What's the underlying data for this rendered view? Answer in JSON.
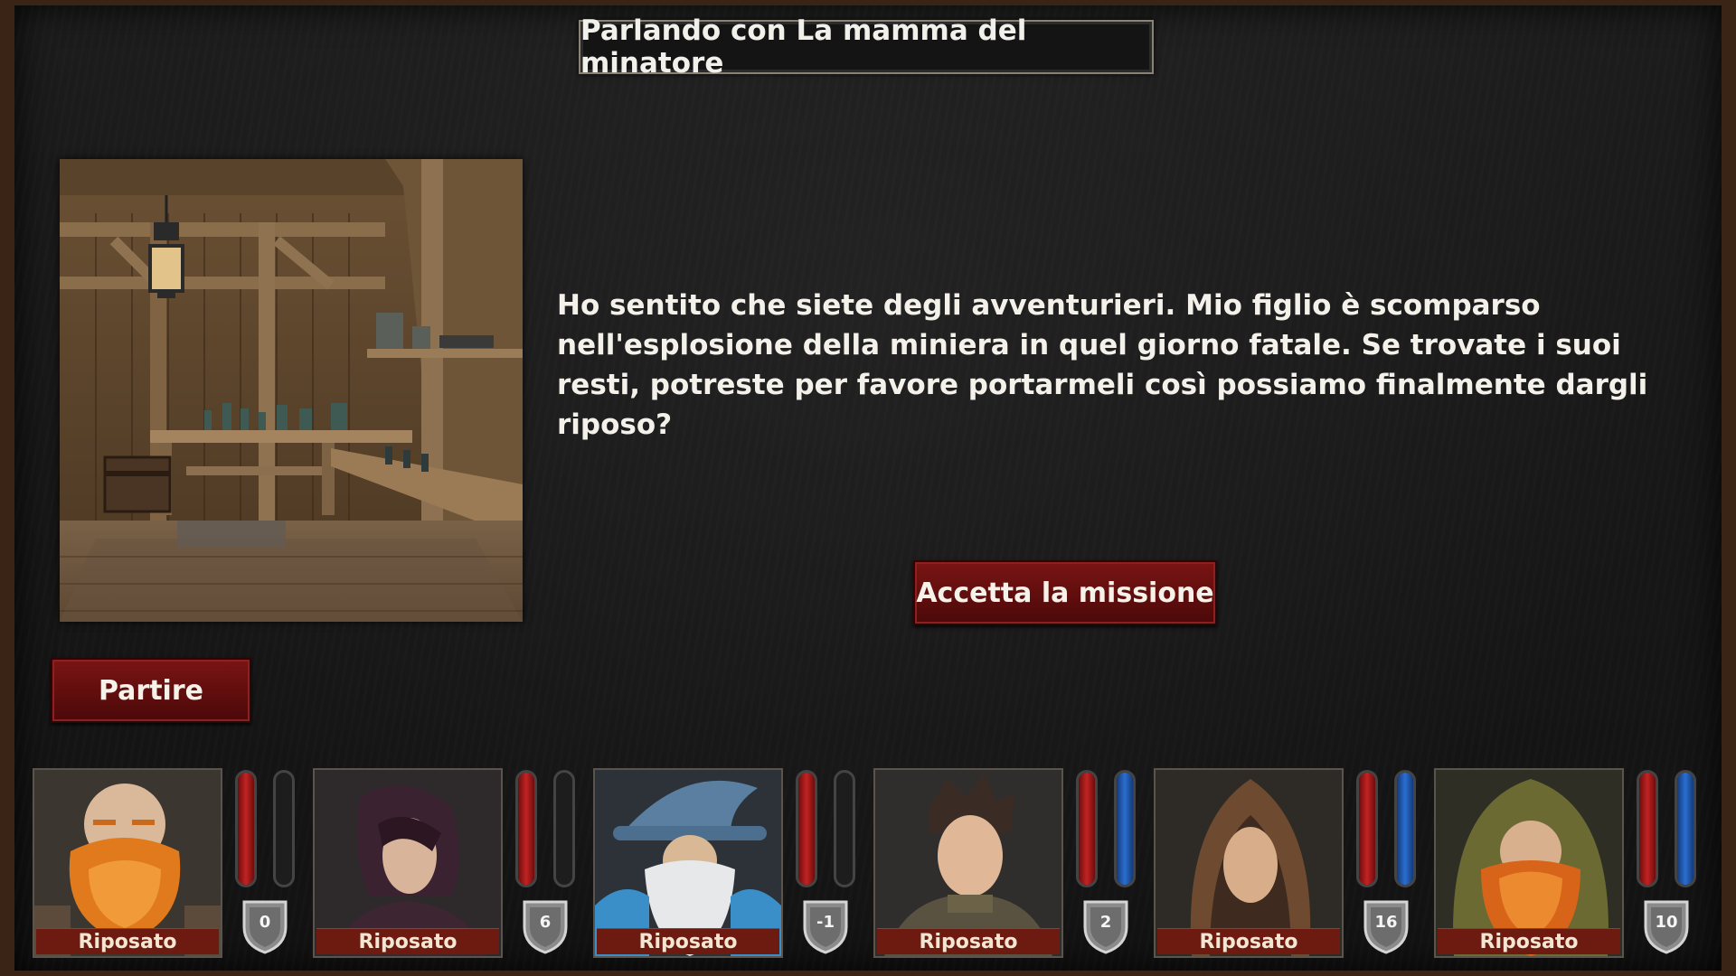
{
  "header": {
    "title": "Parlando con La mamma del minatore"
  },
  "dialogue": {
    "text": "Ho sentito che siete degli avventurieri. Mio figlio è scomparso nell'esplosione della miniera in quel giorno fatale. Se trovate i suoi resti, potreste per favore portarmeli così possiamo finalmente dargli riposo?"
  },
  "actions": {
    "accept_label": "Accetta la missione",
    "depart_label": "Partire"
  },
  "party": [
    {
      "status": "Riposato",
      "armor": "0",
      "hp_fraction": 1.0,
      "mp_fraction": 0.0,
      "portrait": "dwarf-bald"
    },
    {
      "status": "Riposato",
      "armor": "6",
      "hp_fraction": 1.0,
      "mp_fraction": 0.0,
      "portrait": "dark-haired-woman"
    },
    {
      "status": "Riposato",
      "armor": "-1",
      "hp_fraction": 1.0,
      "mp_fraction": 0.0,
      "portrait": "wizard"
    },
    {
      "status": "Riposato",
      "armor": "2",
      "hp_fraction": 1.0,
      "mp_fraction": 1.0,
      "portrait": "young-man"
    },
    {
      "status": "Riposato",
      "armor": "16",
      "hp_fraction": 1.0,
      "mp_fraction": 1.0,
      "portrait": "hooded-woman"
    },
    {
      "status": "Riposato",
      "armor": "10",
      "hp_fraction": 1.0,
      "mp_fraction": 1.0,
      "portrait": "hooded-dwarf"
    }
  ]
}
